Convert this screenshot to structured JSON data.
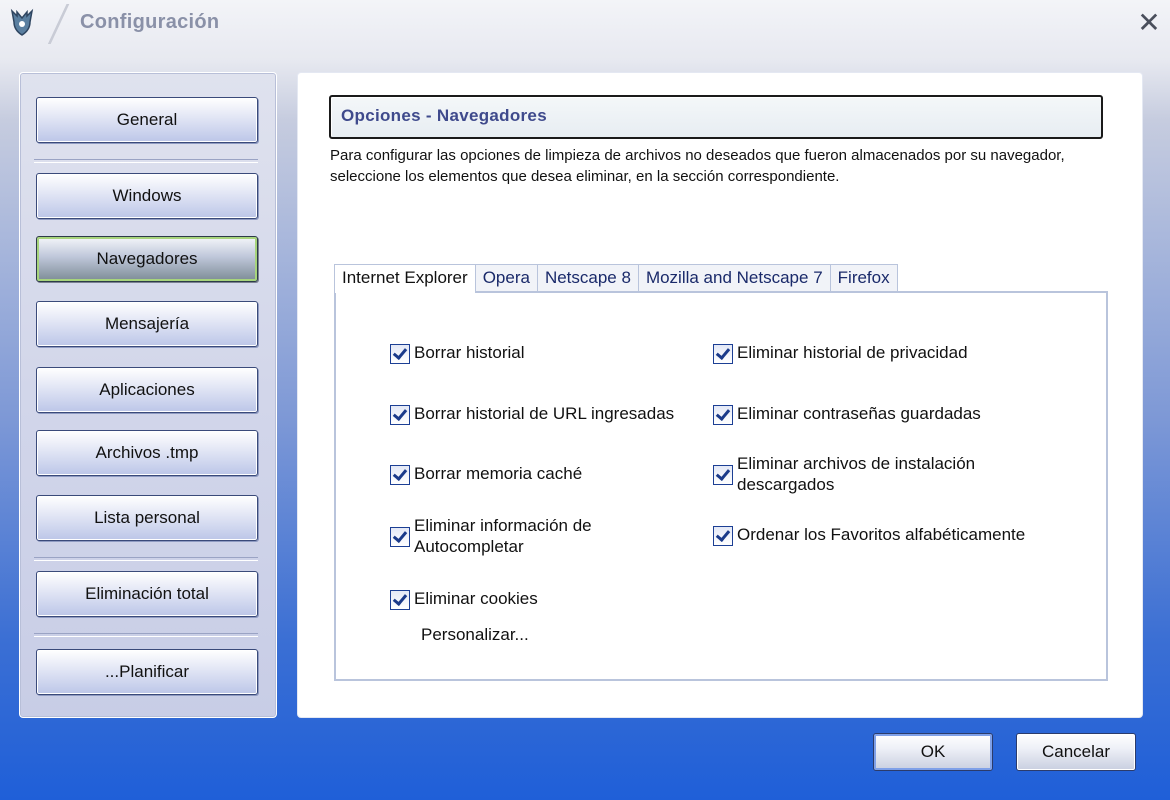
{
  "window": {
    "title": "Configuración",
    "close_icon": "close-icon"
  },
  "nav": {
    "items": [
      {
        "label": "General",
        "active": false
      },
      {
        "label": "Windows",
        "active": false
      },
      {
        "label": "Navegadores",
        "active": true
      },
      {
        "label": "Mensajería",
        "active": false
      },
      {
        "label": "Aplicaciones",
        "active": false
      },
      {
        "label": "Archivos .tmp",
        "active": false
      },
      {
        "label": "Lista personal",
        "active": false
      },
      {
        "label": "Eliminación total",
        "active": false
      },
      {
        "label": "...Planificar",
        "active": false
      }
    ]
  },
  "main": {
    "title": "Opciones - Navegadores",
    "description": "Para configurar las opciones de limpieza de archivos no deseados que fueron almacenados por su navegador, seleccione los elementos que desea eliminar, en la sección correspondiente.",
    "tabs": [
      {
        "label": "Internet Explorer",
        "active": true
      },
      {
        "label": "Opera",
        "active": false
      },
      {
        "label": "Netscape 8",
        "active": false
      },
      {
        "label": "Mozilla and Netscape 7",
        "active": false
      },
      {
        "label": "Firefox",
        "active": false
      }
    ],
    "options_left": [
      {
        "label": "Borrar historial",
        "checked": true
      },
      {
        "label": "Borrar historial de URL ingresadas",
        "checked": true
      },
      {
        "label": "Borrar memoria caché",
        "checked": true
      },
      {
        "label": "Eliminar información de Autocompletar",
        "checked": true
      },
      {
        "label": "Eliminar cookies",
        "checked": true
      }
    ],
    "options_right": [
      {
        "label": "Eliminar historial de privacidad",
        "checked": true
      },
      {
        "label": "Eliminar contraseñas guardadas",
        "checked": true
      },
      {
        "label": "Eliminar archivos de instalación descargados",
        "checked": true
      },
      {
        "label": "Ordenar los Favoritos alfabéticamente",
        "checked": true
      }
    ],
    "customize_label": "Personalizar..."
  },
  "buttons": {
    "ok": "OK",
    "cancel": "Cancelar"
  }
}
